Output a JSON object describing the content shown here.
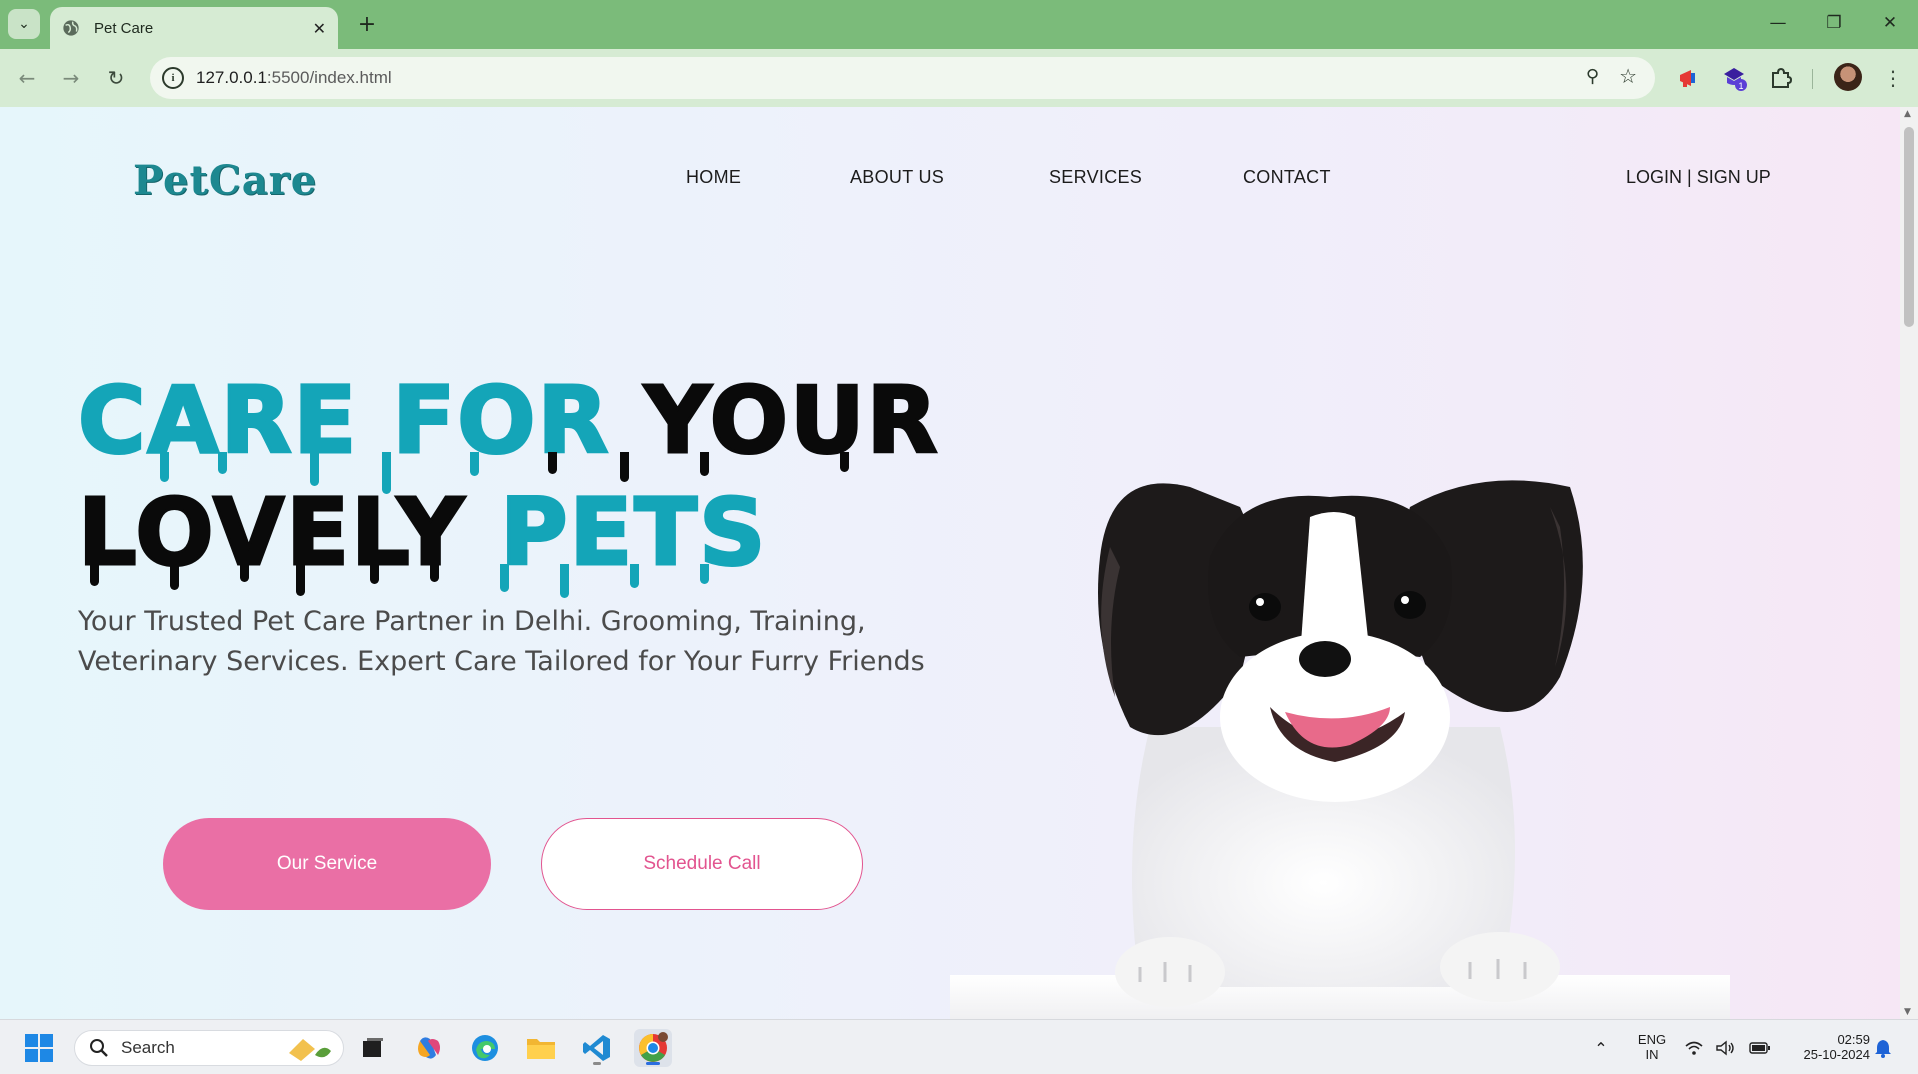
{
  "browser": {
    "tab_title": "Pet Care",
    "new_tab_symbol": "+",
    "url_host": "127.0.0.1",
    "url_path": ":5500/index.html",
    "extension_badge": "1",
    "window_controls": {
      "minimize": "—",
      "restore": "❐",
      "close": "✕"
    }
  },
  "site": {
    "logo": "PetCare",
    "nav": [
      "HOME",
      "ABOUT US",
      "SERVICES",
      "CONTACT"
    ],
    "login": "LOGIN | SIGN UP",
    "hero": {
      "line1_teal": "CARE FOR",
      "line1_black": "YOUR",
      "line2_black": "LOVELY",
      "line2_teal": "PETS"
    },
    "subtitle": "Your Trusted Pet Care Partner in Delhi. Grooming, Training, Veterinary Services. Expert Care Tailored for Your Furry Friends",
    "primary_button": "Our Service",
    "secondary_button": "Schedule Call",
    "colors": {
      "teal": "#14a5b8",
      "pink": "#ea6fa5",
      "logo": "#1d8890"
    }
  },
  "taskbar": {
    "search_label": "Search",
    "language": "ENG",
    "region": "IN",
    "time": "02:59",
    "date": "25-10-2024"
  }
}
